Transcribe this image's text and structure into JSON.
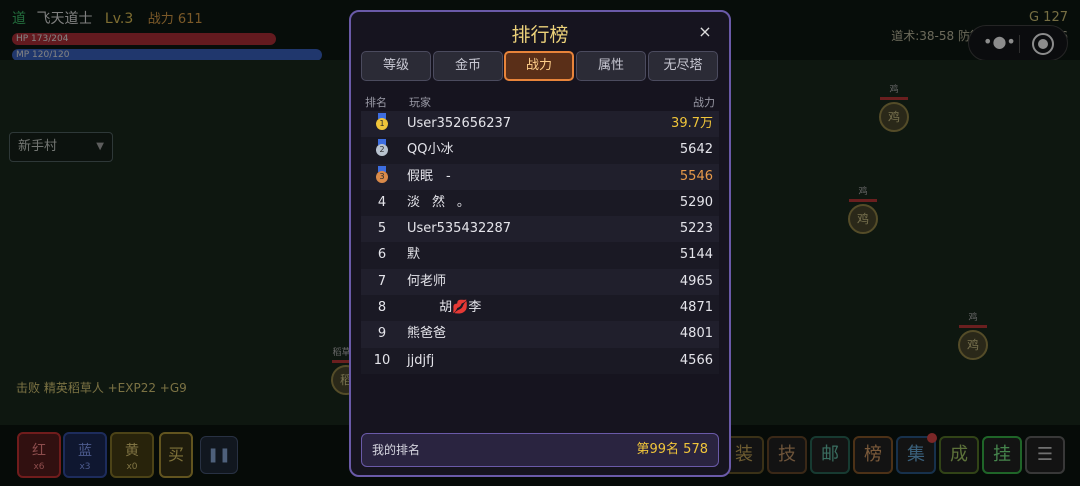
{
  "hud": {
    "class_label": "道",
    "player_name": "飞天道士",
    "level": "Lv.3",
    "power": "战力 611",
    "hp": "HP 173/204",
    "mp": "MP 120/120",
    "hp_fraction": 0.848,
    "mp_fraction": 1.0,
    "gold": "G 127",
    "stats_line": "道术:38-58 防御:24-37 魔防:16",
    "capsule": {
      "more_icon": "•●•",
      "record_icon": "record-icon"
    }
  },
  "map": {
    "selected": "新手村",
    "arrow": "▼"
  },
  "monsters": [
    {
      "name": "鸡",
      "glyph": "鸡"
    },
    {
      "name": "鸡",
      "glyph": "鸡"
    },
    {
      "name": "鸡",
      "glyph": "鸡"
    },
    {
      "name": "稻草人",
      "glyph": "稻"
    }
  ],
  "battle_log": "击败 精英稻草人 +EXP22 +G9",
  "bottom": {
    "potions": [
      {
        "label": "红",
        "count": "x6"
      },
      {
        "label": "蓝",
        "count": "x3"
      },
      {
        "label": "黄",
        "count": "x0"
      }
    ],
    "buy": "买",
    "pause": "❚❚",
    "functions": [
      "装",
      "技",
      "邮",
      "榜",
      "集",
      "成",
      "挂",
      "☰"
    ]
  },
  "leaderboard": {
    "title": "排行榜",
    "close": "×",
    "tabs": [
      "等级",
      "金币",
      "战力",
      "属性",
      "无尽塔"
    ],
    "active_tab": "战力",
    "headers": {
      "rank": "排名",
      "player": "玩家",
      "power": "战力"
    },
    "rows": [
      {
        "rank": "1",
        "name": "User352656237",
        "power": "39.7万"
      },
      {
        "rank": "2",
        "name": "QQ小冰",
        "power": "5642"
      },
      {
        "rank": "3",
        "name": "假眠　-",
        "power": "5546"
      },
      {
        "rank": "4",
        "name": "淡ᅟ然ᅟ。",
        "power": "5290"
      },
      {
        "rank": "5",
        "name": "User535432287",
        "power": "5223"
      },
      {
        "rank": "6",
        "name": "默",
        "power": "5144"
      },
      {
        "rank": "7",
        "name": "何老师",
        "power": "4965"
      },
      {
        "rank": "8",
        "name": "ᅟ ᅟ 胡💋李",
        "power": "4871"
      },
      {
        "rank": "9",
        "name": "熊爸爸",
        "power": "4801"
      },
      {
        "rank": "10",
        "name": "jjdjfj",
        "power": "4566"
      }
    ],
    "my_rank": {
      "label": "我的排名",
      "value": "第99名  578"
    }
  },
  "colors": {
    "modal_border": "#6a5aa8",
    "title_gold": "#ecd27a",
    "active_tab": "#e8843a"
  }
}
